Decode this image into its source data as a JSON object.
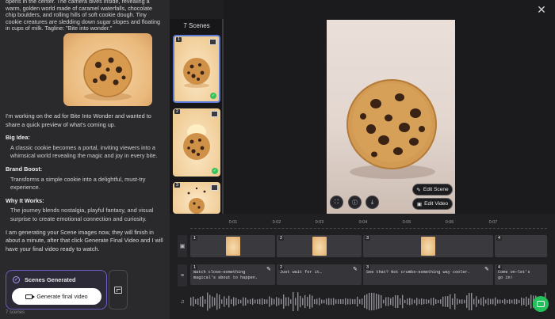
{
  "chat": {
    "prompt_text": "opens in the center. The camera dives inside, revealing a warm, golden world made of caramel waterfalls, chocolate chip boulders, and rolling hills of soft cookie dough. Tiny cookie creatures are sledding down sugar slopes and floating in cups of milk. Tagline: \"Bite into wonder.\"",
    "intro": "I'm working on the ad for Bite Into Wonder and wanted to share a quick preview of what's coming up.",
    "sections": [
      {
        "heading": "Big Idea:",
        "body": "A classic cookie becomes a portal, inviting viewers into a whimsical world revealing the magic and joy in every bite."
      },
      {
        "heading": "Brand Boost:",
        "body": "Transforms a simple cookie into a delightful, must-try experience."
      },
      {
        "heading": "Why It Works:",
        "body": "The journey blends nostalgia, playful fantasy, and visual surprise to create emotional connection and curiosity."
      }
    ],
    "outro": "I am generating your Scene images now, they will finish in about a minute, after that click Generate Final Video and I will have your final video ready to watch.",
    "status_label": "Scenes Generated",
    "generate_button": "Generate final video",
    "footer_count": "7 scenes"
  },
  "scenes": {
    "title": "7 Scenes",
    "items": [
      {
        "num": "1",
        "done": true,
        "selected": true
      },
      {
        "num": "2",
        "done": true,
        "selected": false
      },
      {
        "num": "3",
        "done": false,
        "selected": false
      }
    ]
  },
  "preview": {
    "edit_scene": "Edit Scene",
    "edit_video": "Edit Video"
  },
  "timeline": {
    "ticks": [
      "0:01",
      "0:02",
      "0:03",
      "0:04",
      "0:05",
      "0:06",
      "0:07"
    ],
    "video_clips": [
      "1",
      "2",
      "3",
      "4"
    ],
    "narration": [
      {
        "num": "1",
        "text": "Watch close—something magical's about to happen."
      },
      {
        "num": "2",
        "text": "Just wait for it…"
      },
      {
        "num": "3",
        "text": "See that? Not crumbs—something way cooler."
      },
      {
        "num": "4",
        "text": "Come on—let's go in!"
      }
    ]
  },
  "colors": {
    "accent": "#6b5cc4",
    "selected_border": "#5b7bd6",
    "success": "#35c35c",
    "chat_fab": "#23c15b"
  }
}
